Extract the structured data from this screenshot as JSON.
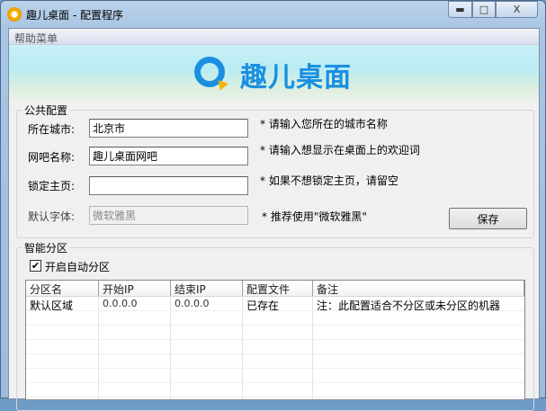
{
  "window": {
    "title": "趣儿桌面 - 配置程序",
    "controls": {
      "minimize": "▬",
      "maximize": "□",
      "close": "X"
    }
  },
  "menu": {
    "help": "帮助菜单"
  },
  "banner": {
    "logo_text": "趣儿桌面",
    "accent": "#1a8fe0"
  },
  "public_config": {
    "legend": "公共配置",
    "city": {
      "label": "所在城市:",
      "value": "北京市",
      "hint": "* 请输入您所在的城市名称"
    },
    "cafe_name": {
      "label": "网吧名称:",
      "value": "趣儿桌面网吧",
      "hint": "* 请输入想显示在桌面上的欢迎词"
    },
    "homepage": {
      "label": "锁定主页:",
      "value": "",
      "hint": "* 如果不想锁定主页，请留空"
    },
    "font": {
      "label": "默认字体:",
      "value": "微软雅黑",
      "hint": "* 推荐使用\"微软雅黑\""
    },
    "save": "保存"
  },
  "smart_partition": {
    "legend": "智能分区",
    "auto_label": "开启自动分区",
    "auto_checked": true,
    "columns": [
      "分区名",
      "开始IP",
      "结束IP",
      "配置文件",
      "备注"
    ],
    "rows": [
      {
        "name": "默认区域",
        "start_ip": "0.0.0.0",
        "end_ip": "0.0.0.0",
        "config": "已存在",
        "note": "注：此配置适合不分区或未分区的机器"
      }
    ]
  }
}
